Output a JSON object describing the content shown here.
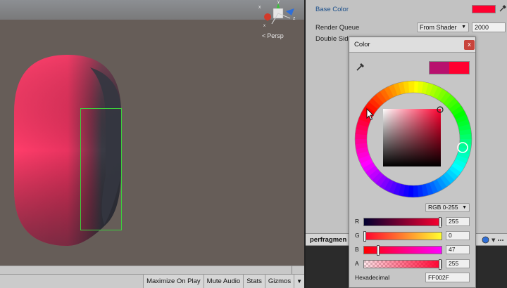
{
  "scene": {
    "persp_label": "Persp",
    "toolbar": {
      "maximize": "Maximize On Play",
      "mute": "Mute Audio",
      "stats": "Stats",
      "gizmos": "Gizmos",
      "gizmos_dropdown": "▼"
    }
  },
  "inspector": {
    "base_color_label": "Base Color",
    "base_color": "#ff002f",
    "render_queue_label": "Render Queue",
    "render_queue_mode": "From Shader",
    "render_queue_value": "2000",
    "double_sided_label": "Double Sid",
    "asset_name": "perfragmen"
  },
  "color_window": {
    "title": "Color",
    "close_label": "x",
    "preview_old": "#b8106e",
    "preview_new": "#ff002f",
    "mode": "RGB 0-255",
    "channels": [
      {
        "label": "R",
        "value": "255",
        "fraction": 1.0
      },
      {
        "label": "G",
        "value": "0",
        "fraction": 0.0
      },
      {
        "label": "B",
        "value": "47",
        "fraction": 0.184
      },
      {
        "label": "A",
        "value": "255",
        "fraction": 1.0
      }
    ],
    "hex_label": "Hexadecimal",
    "hex_value": "FF002F"
  },
  "colors": {
    "accent_blue_label": "#1b4f8a",
    "selection_outline": "#3cd13c",
    "close_button": "#c8443c"
  }
}
